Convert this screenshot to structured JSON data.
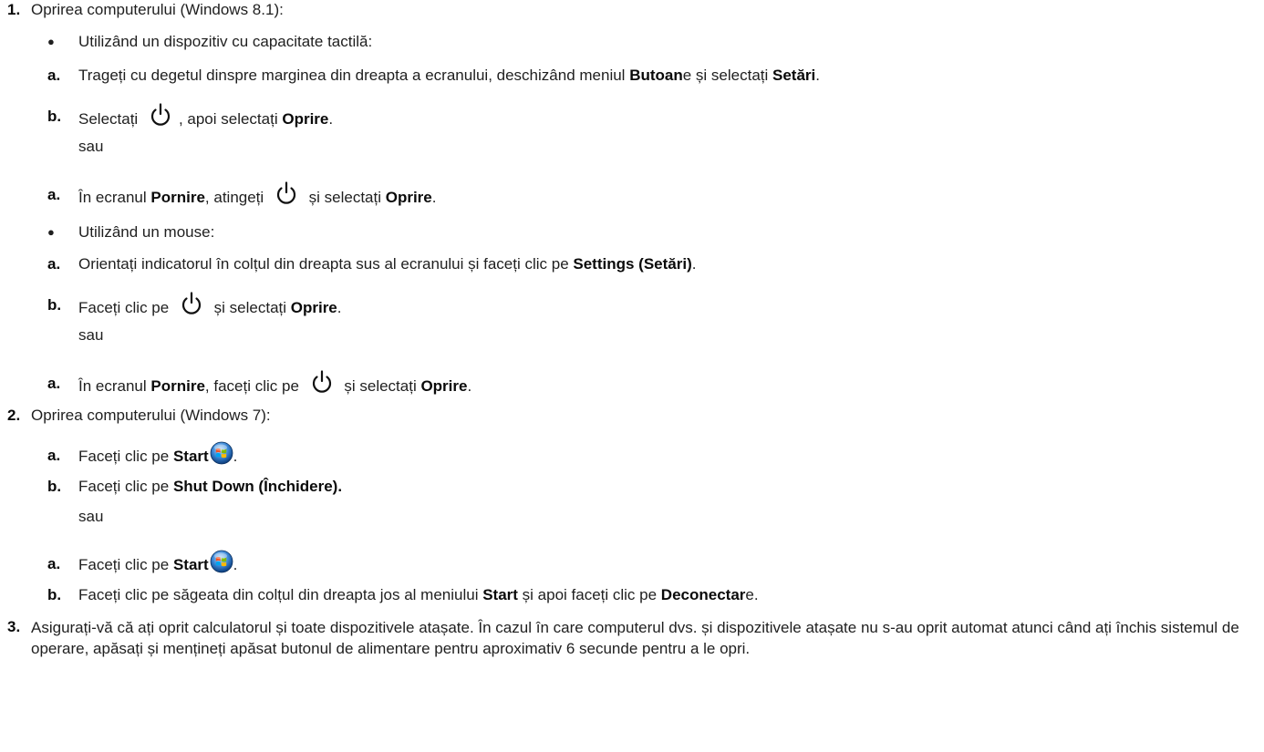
{
  "s1": {
    "num": "1.",
    "title": "Oprirea computerului (Windows 8.1):",
    "touch": {
      "bullet": "●",
      "label": "Utilizând un dispozitiv cu capacitate tactilă:",
      "a1": {
        "marker": "a.",
        "t1": "Trageți cu degetul dinspre marginea din dreapta a ecranului, deschizând meniul ",
        "b1": "Butoan",
        "t2": "e și selectați ",
        "b2": "Setări",
        "t3": "."
      },
      "b1": {
        "marker": "b.",
        "t1": "Selectați ",
        "t2": ", apoi selectați ",
        "b1": "Oprire",
        "t3": "."
      },
      "or": "sau",
      "a2": {
        "marker": "a.",
        "t1": "În ecranul ",
        "b1": "Pornire",
        "t2": ", atingeți ",
        "t3": " și selectați ",
        "b2": "Oprire",
        "t4": "."
      }
    },
    "mouse": {
      "bullet": "●",
      "label": "Utilizând un mouse:",
      "a1": {
        "marker": "a.",
        "t1": "Orientați indicatorul în colțul din dreapta sus al ecranului și faceți clic pe ",
        "b1": "Settings (Setări)",
        "t2": "."
      },
      "b1": {
        "marker": "b.",
        "t1": "Faceți clic pe ",
        "t2": " și selectați ",
        "b1": "Oprire",
        "t3": "."
      },
      "or": "sau",
      "a2": {
        "marker": "a.",
        "t1": "În ecranul ",
        "b1": "Pornire",
        "t2": ", faceți clic pe ",
        "t3": " și selectați ",
        "b2": "Oprire",
        "t4": "."
      }
    }
  },
  "s2": {
    "num": "2.",
    "title": "Oprirea computerului (Windows 7):",
    "a1": {
      "marker": "a.",
      "t1": "Faceți clic pe ",
      "b1": "Start",
      "t2": "."
    },
    "b1": {
      "marker": "b.",
      "t1": "Faceți clic pe ",
      "b1": "Shut Down (Închidere)."
    },
    "or": "sau",
    "a2": {
      "marker": "a.",
      "t1": "Faceți clic pe ",
      "b1": "Start",
      "t2": "."
    },
    "b2": {
      "marker": "b.",
      "t1": "Faceți clic pe săgeata din colțul din dreapta jos al meniului ",
      "b1": "Start",
      "t2": " și apoi faceți clic pe ",
      "b2": "Deconectar",
      "t3": "e."
    }
  },
  "s3": {
    "num": "3.",
    "text": "Asigurați-vă că ați oprit calculatorul și toate dispozitivele atașate. În cazul în care computerul dvs. și dispozitivele atașate nu s-au oprit automat atunci când ați închis sistemul de operare, apăsați și mențineți apăsat butonul de alimentare pentru aproximativ 6 secunde pentru a le opri."
  },
  "icons": [
    "power-icon",
    "windows-start-orb-icon"
  ]
}
